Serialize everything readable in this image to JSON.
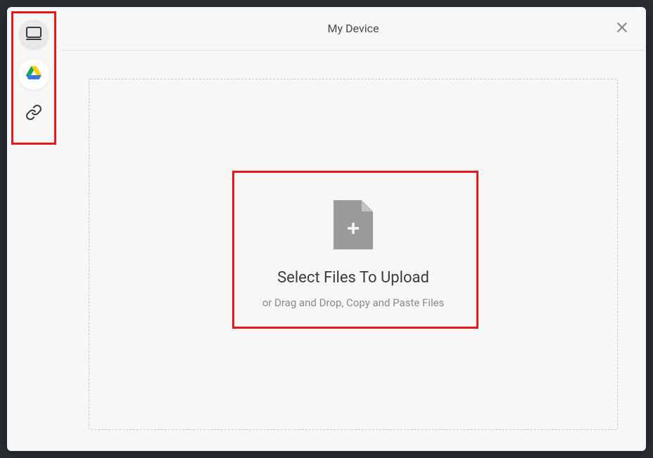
{
  "header": {
    "title": "My Device"
  },
  "sidebar": {
    "items": [
      {
        "name": "my-device",
        "icon": "monitor-icon"
      },
      {
        "name": "google-drive",
        "icon": "google-drive-icon"
      },
      {
        "name": "link",
        "icon": "link-icon"
      }
    ]
  },
  "upload": {
    "title": "Select Files To Upload",
    "subtitle": "or Drag and Drop, Copy and Paste Files"
  }
}
